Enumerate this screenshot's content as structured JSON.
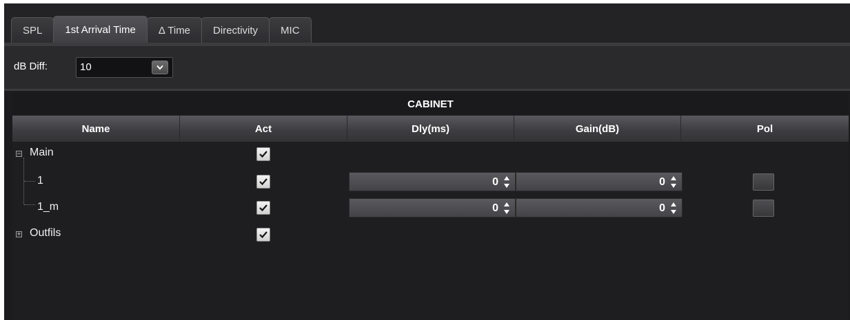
{
  "tabs": [
    {
      "label": "SPL",
      "active": false
    },
    {
      "label": "1st Arrival Time",
      "active": true
    },
    {
      "label": "Δ Time",
      "active": false
    },
    {
      "label": "Directivity",
      "active": false
    },
    {
      "label": "MIC",
      "active": false
    }
  ],
  "db_diff": {
    "label": "dB Diff:",
    "value": "10",
    "dropdown_icon": "chevron-down-icon"
  },
  "table": {
    "section_title": "CABINET",
    "columns": [
      "Name",
      "Act",
      "Dly(ms)",
      "Gain(dB)",
      "Pol"
    ],
    "rows": [
      {
        "name": "Main",
        "toggle": "−",
        "expanded": true,
        "act": true
      },
      {
        "name": "1",
        "act": true,
        "dly": "0",
        "gain": "0",
        "pol": false
      },
      {
        "name": "1_m",
        "act": true,
        "dly": "0",
        "gain": "0",
        "pol": false
      },
      {
        "name": "Outfils",
        "toggle": "+",
        "expanded": false,
        "act": true
      }
    ]
  },
  "colors": {
    "background": "#1c1c1e",
    "header": "#3e3e42",
    "spin_field": "#4e4e52",
    "checkbox": "#e8e8e8"
  }
}
